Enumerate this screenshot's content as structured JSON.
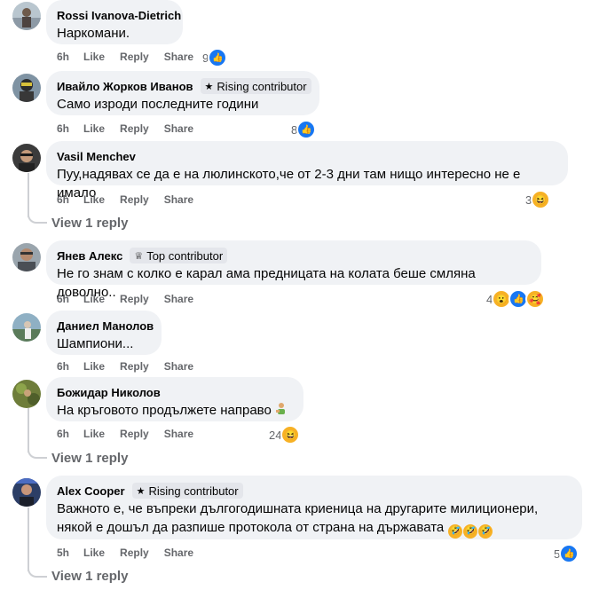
{
  "comments": [
    {
      "name": "Rossi Ivanova-Dietrich",
      "badge": "",
      "text": "Наркомани.",
      "time": "6h",
      "like": "Like",
      "reply": "Reply",
      "share": "Share",
      "count": "9",
      "reactions": [
        "like"
      ]
    },
    {
      "name": "Ивайло Жорков Иванов",
      "badge": "Rising contributor",
      "text": "Само изроди последните години",
      "time": "6h",
      "like": "Like",
      "reply": "Reply",
      "share": "Share",
      "count": "8",
      "reactions": [
        "like"
      ]
    },
    {
      "name": "Vasil Menchev",
      "badge": "",
      "text": "Пуу,надявах се да е на люлинското,че от 2-3 дни там нищо интересно не е имало",
      "time": "6h",
      "like": "Like",
      "reply": "Reply",
      "share": "Share",
      "count": "3",
      "reactions": [
        "haha"
      ],
      "view_replies": "View 1 reply"
    },
    {
      "name": "Янев Алекс",
      "badge": "Top contributor",
      "text": "Не го знам с колко е карал ама предницата на колата беше смляна доволно..",
      "time": "6h",
      "like": "Like",
      "reply": "Reply",
      "share": "Share",
      "count": "4",
      "reactions": [
        "wow",
        "like",
        "care"
      ]
    },
    {
      "name": "Даниел Манолов",
      "badge": "",
      "text": "Шампиони...",
      "time": "6h",
      "like": "Like",
      "reply": "Reply",
      "share": "Share",
      "count": "",
      "reactions": []
    },
    {
      "name": "Божидар Николов",
      "badge": "",
      "text": "На кръговото продължете направо",
      "time": "6h",
      "like": "Like",
      "reply": "Reply",
      "share": "Share",
      "count": "24",
      "reactions": [
        "haha"
      ],
      "view_replies": "View 1 reply"
    },
    {
      "name": "Alex Cooper",
      "badge": "Rising contributor",
      "text_line1": "Важното е, че въпреки дългогодишната криеница на другарите милиционери,",
      "text_line2": "някой е дошъл да разпише протокола от страна на държавата",
      "time": "5h",
      "like": "Like",
      "reply": "Reply",
      "share": "Share",
      "count": "5",
      "reactions": [
        "like"
      ],
      "view_replies": "View 1 reply"
    }
  ],
  "icons": {
    "like": "thumbs-up-icon",
    "haha": "laughing-emoji-icon",
    "wow": "surprised-emoji-icon",
    "care": "care-emoji-icon",
    "star": "star-icon",
    "badge_top": "top-contributor-icon"
  },
  "colors": {
    "bubble": "#f0f2f5",
    "meta": "#65676b",
    "like_blue": "#1877f2",
    "emoji_yellow": "#f7b125"
  }
}
